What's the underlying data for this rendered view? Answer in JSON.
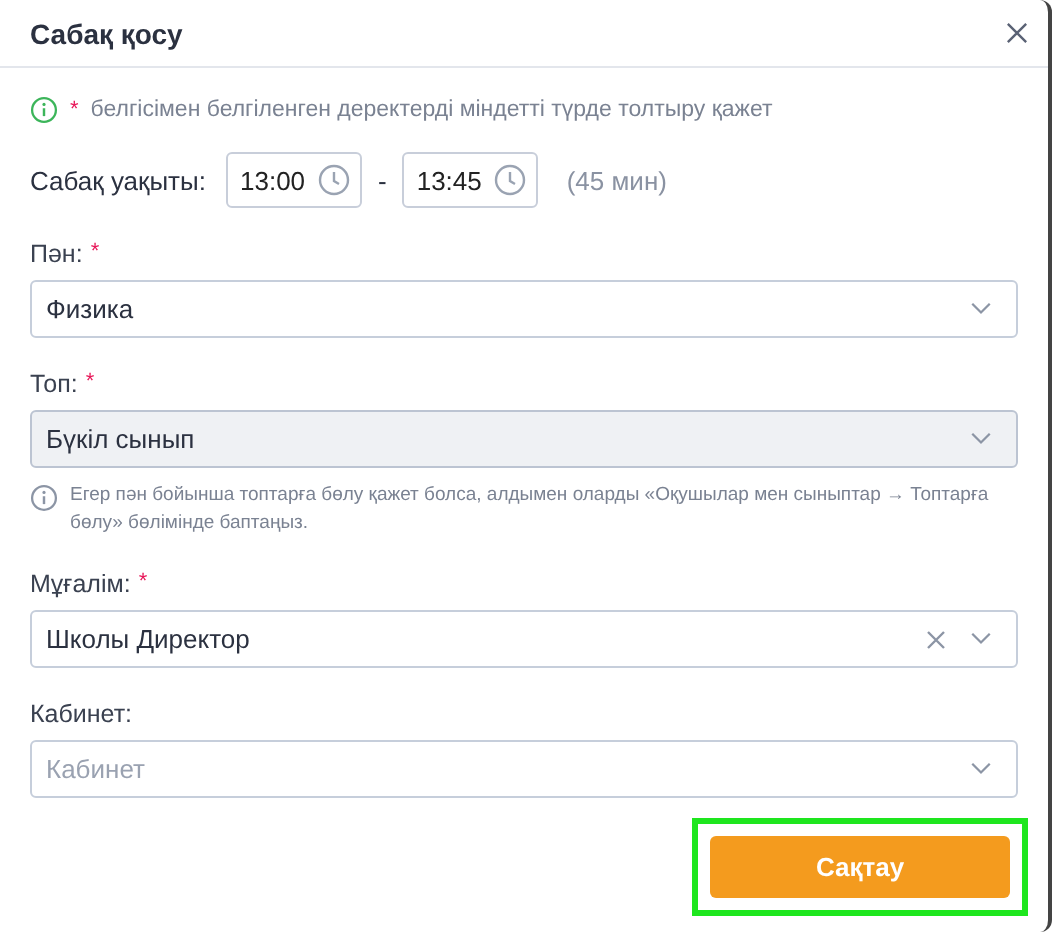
{
  "dialog": {
    "title": "Сабақ қосу"
  },
  "notice": {
    "mark": "*",
    "text": "белгісімен белгіленген деректерді міндетті түрде толтыру қажет"
  },
  "time": {
    "label": "Сабақ уақыты:",
    "start": "13:00",
    "separator": "-",
    "end": "13:45",
    "duration": "(45 мин)"
  },
  "fields": [
    {
      "kind": "select",
      "label": "Пән:",
      "required_mark": "*",
      "value": "Физика",
      "disabled": false,
      "clearable": false
    },
    {
      "kind": "select",
      "label": "Топ:",
      "required_mark": "*",
      "value": "Бүкіл сынып",
      "disabled": true,
      "clearable": false,
      "hint": "Егер пән бойынша топтарға бөлу қажет болса, алдымен оларды «Оқушылар мен сыныптар → Топтарға бөлу» бөлімінде баптаңыз."
    },
    {
      "kind": "select",
      "label": "Мұғалім:",
      "required_mark": "*",
      "value": "Школы Директор",
      "disabled": false,
      "clearable": true
    },
    {
      "kind": "select",
      "label": "Кабинет:",
      "placeholder": "Кабинет",
      "disabled": false,
      "clearable": false
    }
  ],
  "save_button": {
    "label": "Сақтау",
    "highlighted": true
  }
}
